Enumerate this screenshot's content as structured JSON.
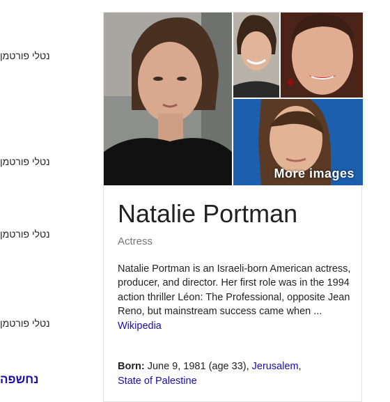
{
  "left_results": [
    {
      "text": "נטלי פורטמן"
    },
    {
      "text": "נטלי פורטמן"
    },
    {
      "text": "נטלי פורטמן"
    },
    {
      "text": "נטלי פורטמן"
    }
  ],
  "left_link": "נחשפה",
  "knowledge_panel": {
    "more_images": "More images",
    "title": "Natalie Portman",
    "subtitle": "Actress",
    "description": "Natalie Portman is an Israeli-born American actress, producer, and director. Her first role was in the 1994 action thriller Léon: The Professional, opposite Jean Reno, but mainstream success came when ...",
    "source": "Wikipedia",
    "born_label": "Born:",
    "born_value": "June 9, 1981 (age 33),",
    "born_place_1": "Jerusalem",
    "born_place_sep": ",",
    "born_place_2": "State of Palestine"
  },
  "colors": {
    "link": "#1a0dab",
    "text": "#222222",
    "muted": "#777777",
    "photo_blue": "#1b5fae"
  }
}
